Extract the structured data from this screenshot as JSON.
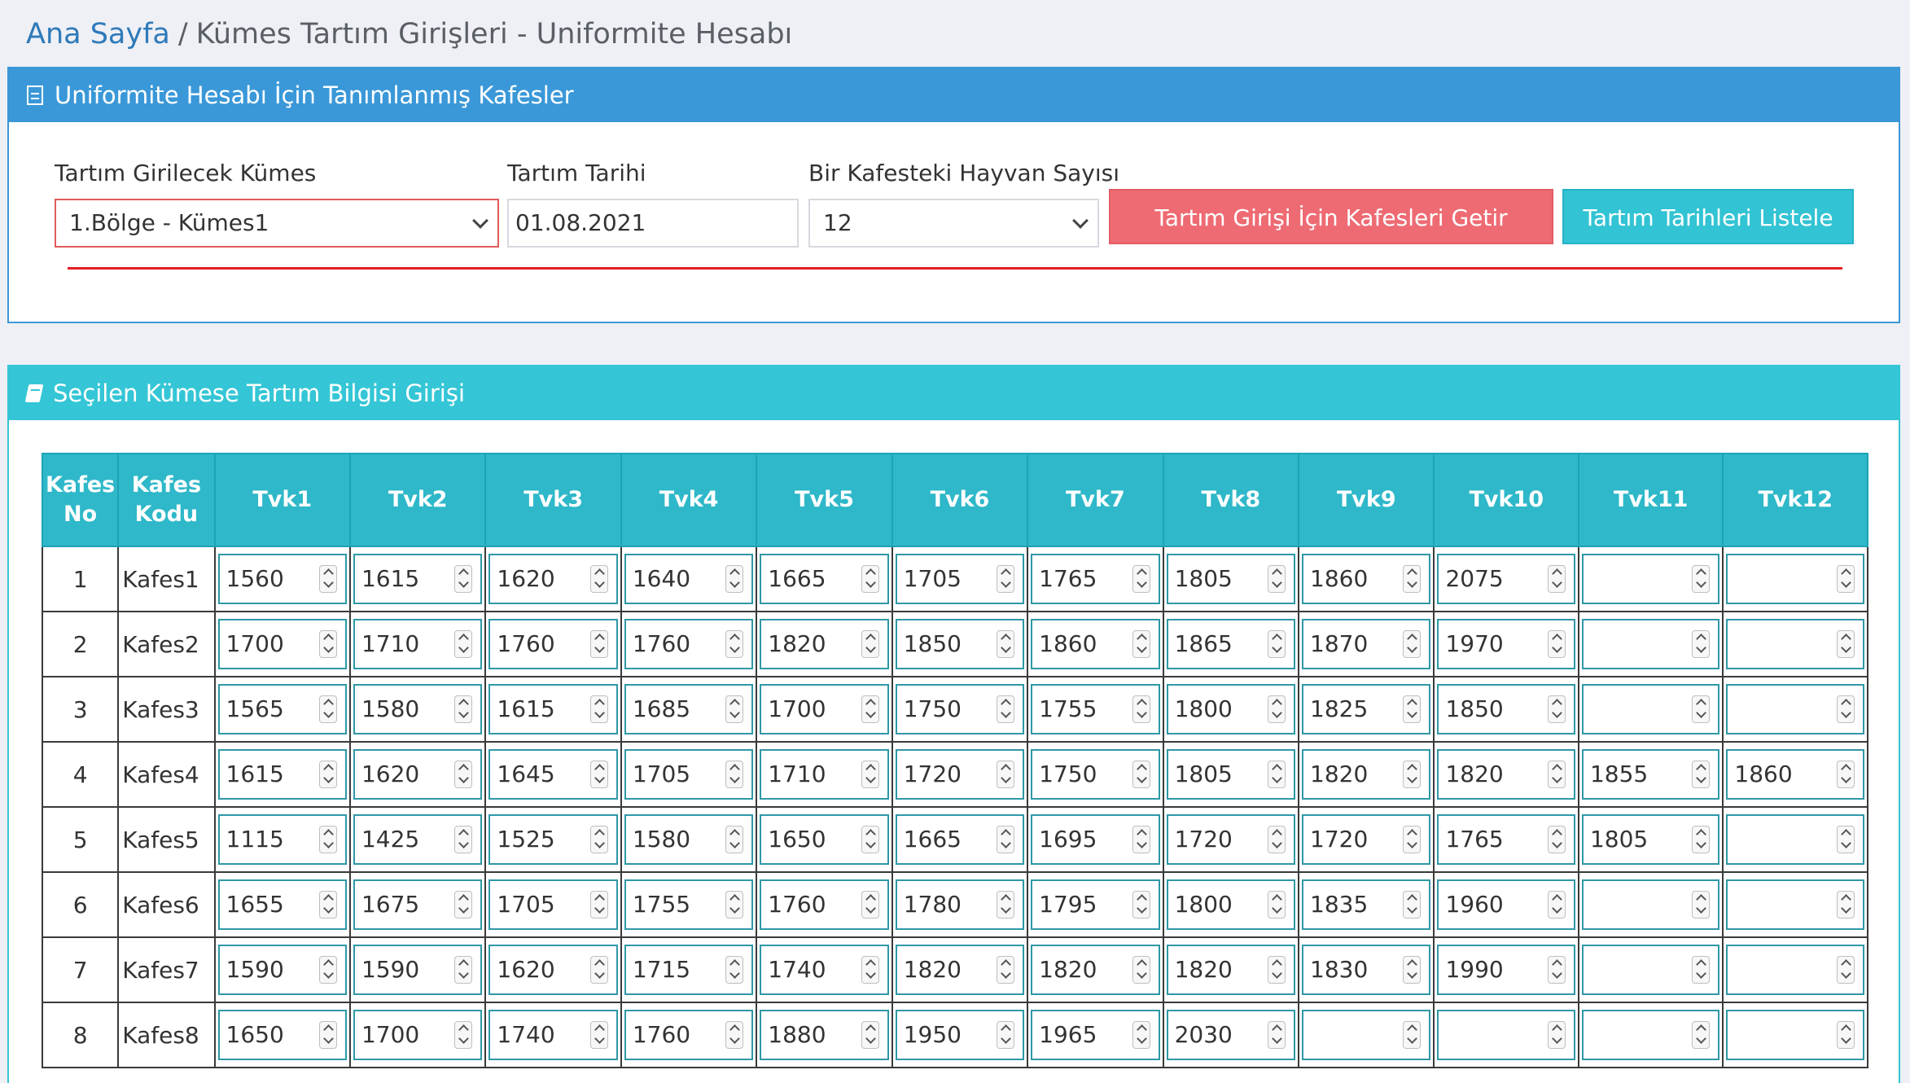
{
  "breadcrumb": {
    "home": "Ana Sayfa",
    "separator": "/",
    "current": "Kümes Tartım Girişleri - Uniformite Hesabı"
  },
  "filter_panel": {
    "title": "Uniformite Hesabı İçin Tanımlanmış Kafesler",
    "icon": "document-icon",
    "kumes_label": "Tartım Girilecek Kümes",
    "kumes_value": "1.Bölge - Kümes1",
    "date_label": "Tartım Tarihi",
    "date_value": "01.08.2021",
    "count_label": "Bir Kafesteki Hayvan Sayısı",
    "count_value": "12",
    "fetch_button": "Tartım Girişi İçin Kafesleri Getir",
    "list_button": "Tartım Tarihleri Listele",
    "colors": {
      "header": "#3a98d8",
      "fetch_button": "#ee6b73",
      "list_button": "#32c3d4",
      "divider": "#e31d23"
    }
  },
  "entry_panel": {
    "title": "Seçilen Kümese Tartım Bilgisi Girişi",
    "icon": "book-icon",
    "colors": {
      "header": "#34c6d6",
      "table_header": "#2eb8c9"
    },
    "table": {
      "header_no": "Kafes No",
      "header_code": "Kafes Kodu",
      "tvk_headers": [
        "Tvk1",
        "Tvk2",
        "Tvk3",
        "Tvk4",
        "Tvk5",
        "Tvk6",
        "Tvk7",
        "Tvk8",
        "Tvk9",
        "Tvk10",
        "Tvk11",
        "Tvk12"
      ],
      "rows": [
        {
          "no": "1",
          "code": "Kafes1",
          "values": [
            "1560",
            "1615",
            "1620",
            "1640",
            "1665",
            "1705",
            "1765",
            "1805",
            "1860",
            "2075",
            "",
            ""
          ]
        },
        {
          "no": "2",
          "code": "Kafes2",
          "values": [
            "1700",
            "1710",
            "1760",
            "1760",
            "1820",
            "1850",
            "1860",
            "1865",
            "1870",
            "1970",
            "",
            ""
          ]
        },
        {
          "no": "3",
          "code": "Kafes3",
          "values": [
            "1565",
            "1580",
            "1615",
            "1685",
            "1700",
            "1750",
            "1755",
            "1800",
            "1825",
            "1850",
            "",
            ""
          ]
        },
        {
          "no": "4",
          "code": "Kafes4",
          "values": [
            "1615",
            "1620",
            "1645",
            "1705",
            "1710",
            "1720",
            "1750",
            "1805",
            "1820",
            "1820",
            "1855",
            "1860"
          ]
        },
        {
          "no": "5",
          "code": "Kafes5",
          "values": [
            "1115",
            "1425",
            "1525",
            "1580",
            "1650",
            "1665",
            "1695",
            "1720",
            "1720",
            "1765",
            "1805",
            ""
          ]
        },
        {
          "no": "6",
          "code": "Kafes6",
          "values": [
            "1655",
            "1675",
            "1705",
            "1755",
            "1760",
            "1780",
            "1795",
            "1800",
            "1835",
            "1960",
            "",
            ""
          ]
        },
        {
          "no": "7",
          "code": "Kafes7",
          "values": [
            "1590",
            "1590",
            "1620",
            "1715",
            "1740",
            "1820",
            "1820",
            "1820",
            "1830",
            "1990",
            "",
            ""
          ]
        },
        {
          "no": "8",
          "code": "Kafes8",
          "values": [
            "1650",
            "1700",
            "1740",
            "1760",
            "1880",
            "1950",
            "1965",
            "2030",
            "",
            "",
            "",
            ""
          ]
        }
      ]
    }
  }
}
